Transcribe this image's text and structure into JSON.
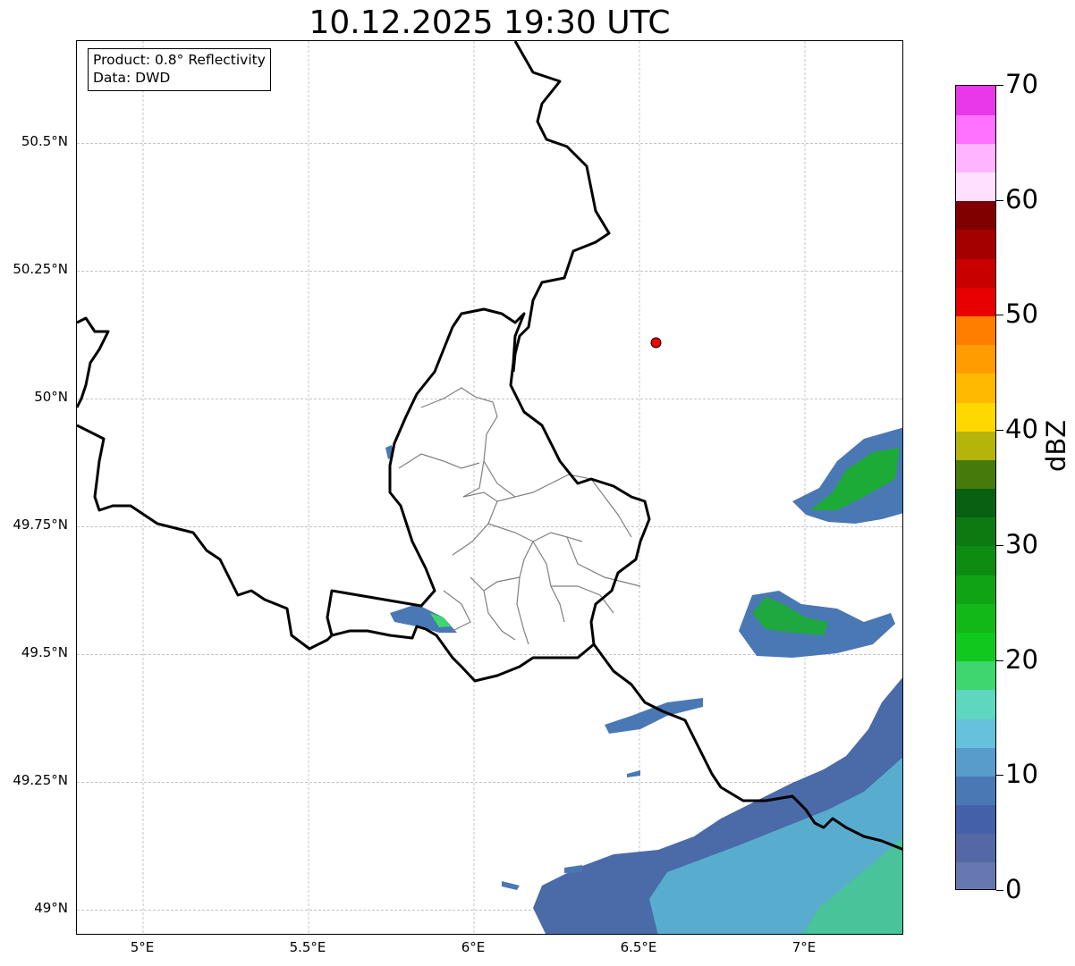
{
  "title": "10.12.2025 19:30 UTC",
  "info_box": {
    "product": "Product: 0.8° Reflectivity",
    "data": "Data: DWD"
  },
  "map": {
    "extent": {
      "lon_min": 4.8,
      "lon_max": 7.3,
      "lat_min": 48.95,
      "lat_max": 50.7
    },
    "lat_ticks": [
      {
        "value": 50.5,
        "label": "50.5°N"
      },
      {
        "value": 50.25,
        "label": "50.25°N"
      },
      {
        "value": 50.0,
        "label": "50°N"
      },
      {
        "value": 49.75,
        "label": "49.75°N"
      },
      {
        "value": 49.5,
        "label": "49.5°N"
      },
      {
        "value": 49.25,
        "label": "49.25°N"
      },
      {
        "value": 49.0,
        "label": "49°N"
      }
    ],
    "lon_ticks": [
      {
        "value": 5.0,
        "label": "5°E"
      },
      {
        "value": 5.5,
        "label": "5.5°E"
      },
      {
        "value": 6.0,
        "label": "6°E"
      },
      {
        "value": 6.5,
        "label": "6.5°E"
      },
      {
        "value": 7.0,
        "label": "7°E"
      }
    ],
    "gridlines": true,
    "radar_site": {
      "lon": 6.55,
      "lat": 50.11,
      "color": "#ff0000"
    }
  },
  "colorbar": {
    "unit": "dBZ",
    "min": 0,
    "max": 70,
    "ticks": [
      {
        "value": 0,
        "label": "0"
      },
      {
        "value": 10,
        "label": "10"
      },
      {
        "value": 20,
        "label": "20"
      },
      {
        "value": 30,
        "label": "30"
      },
      {
        "value": 40,
        "label": "40"
      },
      {
        "value": 50,
        "label": "50"
      },
      {
        "value": 60,
        "label": "60"
      },
      {
        "value": 70,
        "label": "70"
      }
    ],
    "colors": [
      "#6678b0",
      "#5368a4",
      "#4460a8",
      "#4a78b4",
      "#589ccc",
      "#66c1dc",
      "#5fd6c0",
      "#3ed66e",
      "#10c81e",
      "#12b818",
      "#10a414",
      "#0e8c12",
      "#0c7a10",
      "#086010",
      "#467a0a",
      "#b4b40a",
      "#ffd800",
      "#ffba00",
      "#ff9c00",
      "#ff7e00",
      "#e80000",
      "#c80000",
      "#a40000",
      "#800000",
      "#ffe0ff",
      "#ffb4ff",
      "#ff72ff",
      "#e838e8"
    ]
  }
}
